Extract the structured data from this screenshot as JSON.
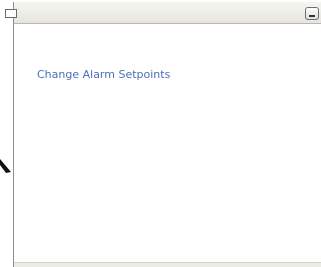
{
  "window": {
    "link_label": "Change Alarm Setpoints"
  }
}
